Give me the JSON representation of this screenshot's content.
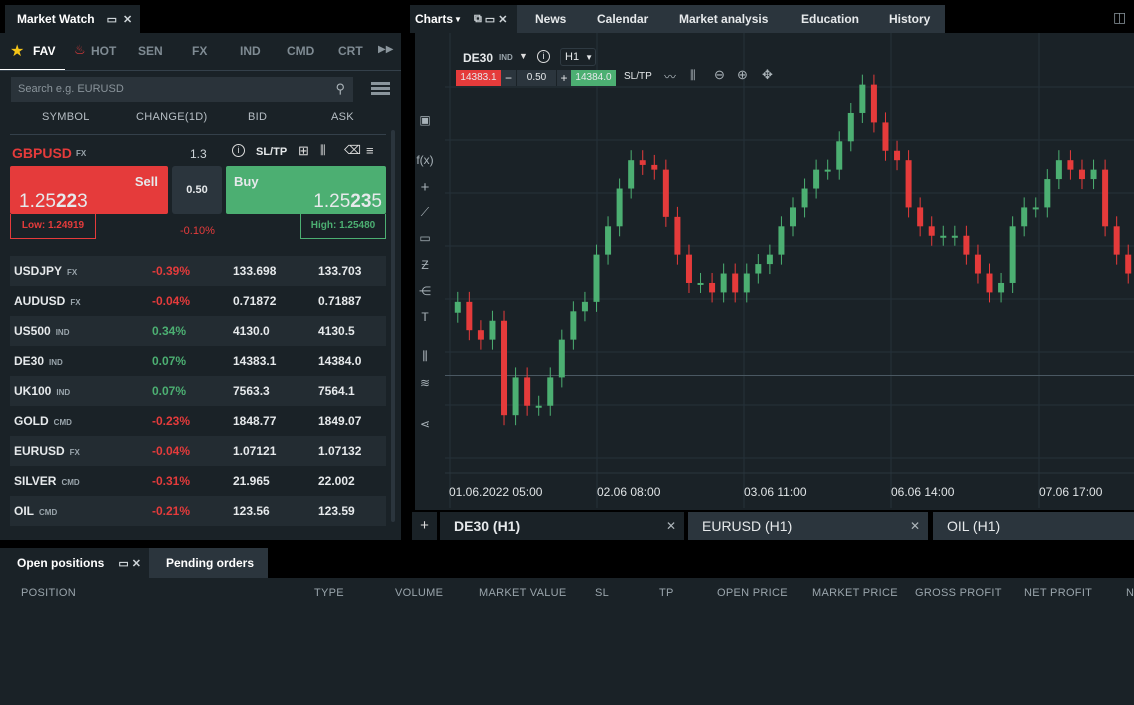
{
  "market_watch": {
    "title": "Market Watch",
    "categories": [
      "FAV",
      "HOT",
      "SEN",
      "FX",
      "IND",
      "CMD",
      "CRT"
    ],
    "search_placeholder": "Search e.g. EURUSD",
    "columns": [
      "SYMBOL",
      "CHANGE(1D)",
      "BID",
      "ASK"
    ],
    "selected": {
      "symbol": "GBPUSD",
      "type": "FX",
      "spread": "1.3",
      "sltp": "SL/TP",
      "sell_label": "Sell",
      "sell_price_pre": "1.25",
      "sell_price_big": "22",
      "sell_price_post": "3",
      "volume": "0.50",
      "buy_label": "Buy",
      "buy_price_pre": "1.25",
      "buy_price_big": "23",
      "buy_price_post": "5",
      "low": "Low: 1.24919",
      "change": "-0.10%",
      "high": "High: 1.25480"
    },
    "rows": [
      {
        "symbol": "USDJPY",
        "type": "FX",
        "change": "-0.39%",
        "bid": "133.698",
        "ask": "133.703",
        "dir": "down"
      },
      {
        "symbol": "AUDUSD",
        "type": "FX",
        "change": "-0.04%",
        "bid": "0.71872",
        "ask": "0.71887",
        "dir": "down"
      },
      {
        "symbol": "US500",
        "type": "IND",
        "change": "0.34%",
        "bid": "4130.0",
        "ask": "4130.5",
        "dir": "up"
      },
      {
        "symbol": "DE30",
        "type": "IND",
        "change": "0.07%",
        "bid": "14383.1",
        "ask": "14384.0",
        "dir": "up"
      },
      {
        "symbol": "UK100",
        "type": "IND",
        "change": "0.07%",
        "bid": "7563.3",
        "ask": "7564.1",
        "dir": "up"
      },
      {
        "symbol": "GOLD",
        "type": "CMD",
        "change": "-0.23%",
        "bid": "1848.77",
        "ask": "1849.07",
        "dir": "down"
      },
      {
        "symbol": "EURUSD",
        "type": "FX",
        "change": "-0.04%",
        "bid": "1.07121",
        "ask": "1.07132",
        "dir": "down"
      },
      {
        "symbol": "SILVER",
        "type": "CMD",
        "change": "-0.31%",
        "bid": "21.965",
        "ask": "22.002",
        "dir": "down"
      },
      {
        "symbol": "OIL",
        "type": "CMD",
        "change": "-0.21%",
        "bid": "123.56",
        "ask": "123.59",
        "dir": "down"
      }
    ]
  },
  "charts": {
    "title": "Charts",
    "tabs": [
      "News",
      "Calendar",
      "Market analysis",
      "Education",
      "History"
    ],
    "symbol": "DE30",
    "symbol_type": "IND",
    "timeframe": "H1",
    "sell_price": "14383.1",
    "volume": "0.50",
    "buy_price": "14384.0",
    "sltp": "SL/TP",
    "chart_tabs": [
      {
        "label": "DE30 (H1)",
        "active": true
      },
      {
        "label": "EURUSD (H1)",
        "active": false
      },
      {
        "label": "OIL (H1)",
        "active": false
      }
    ]
  },
  "chart_data": {
    "type": "candlestick",
    "x_tick_labels": [
      "01.06.2022 05:00",
      "02.06 08:00",
      "03.06 11:00",
      "06.06 14:00",
      "07.06 17:00"
    ],
    "first_open": 14300,
    "closes": [
      14323,
      14263,
      14243,
      14283,
      14083,
      14163,
      14103,
      14103,
      14163,
      14243,
      14303,
      14323,
      14423,
      14483,
      14563,
      14623,
      14613,
      14603,
      14503,
      14423,
      14363,
      14363,
      14343,
      14383,
      14343,
      14383,
      14403,
      14423,
      14483,
      14523,
      14563,
      14603,
      14603,
      14663,
      14723,
      14783,
      14703,
      14643,
      14623,
      14523,
      14483,
      14463,
      14463,
      14463,
      14423,
      14383,
      14343,
      14363,
      14483,
      14523,
      14523,
      14583,
      14623,
      14603,
      14583,
      14603,
      14483,
      14423,
      14383
    ],
    "ylim": [
      13950,
      14850
    ],
    "price_line": 14167,
    "colors": {
      "up": "#4caf72",
      "down": "#e53b3b"
    }
  },
  "positions": {
    "tabs": [
      "Open positions",
      "Pending orders"
    ],
    "columns": [
      "POSITION",
      "TYPE",
      "VOLUME",
      "MARKET VALUE",
      "SL",
      "TP",
      "OPEN PRICE",
      "MARKET PRICE",
      "GROSS PROFIT",
      "NET PROFIT",
      "N"
    ]
  }
}
